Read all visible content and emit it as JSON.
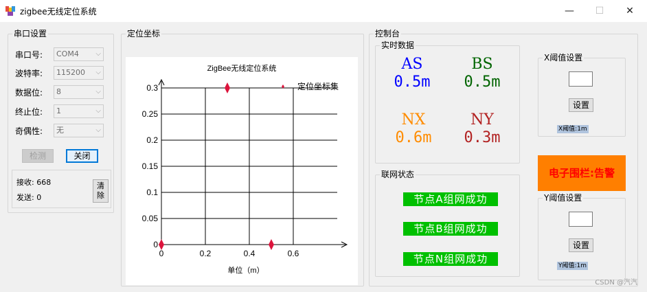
{
  "window": {
    "title": "zigbee无线定位系统",
    "minimize": "—",
    "maximize": "☐",
    "close": "✕"
  },
  "serial": {
    "legend": "串口设置",
    "fields": [
      {
        "label": "串口号:",
        "value": "COM4"
      },
      {
        "label": "波特率:",
        "value": "115200"
      },
      {
        "label": "数据位:",
        "value": "8"
      },
      {
        "label": "终止位:",
        "value": "1"
      },
      {
        "label": "奇偶性:",
        "value": "无"
      }
    ],
    "detect_label": "检测",
    "close_label": "关闭",
    "recv_label": "接收: 668",
    "send_label": "发送: 0",
    "clear_label_1": "清",
    "clear_label_2": "除"
  },
  "coords": {
    "legend": "定位坐标"
  },
  "chart_data": {
    "type": "scatter",
    "title": "ZigBee无线定位系统",
    "xlabel": "单位（m）",
    "ylabel": "",
    "xlim": [
      0,
      0.7
    ],
    "ylim": [
      0,
      0.3
    ],
    "xticks": [
      "0",
      "0.2",
      "0.4",
      "0.6"
    ],
    "yticks": [
      "0",
      "0.05",
      "0.1",
      "0.15",
      "0.2",
      "0.25",
      "0.3"
    ],
    "grid": true,
    "legend_position": "top-right",
    "series": [
      {
        "name": "定位坐标集",
        "color": "#dc143c",
        "x": [
          0,
          0.3,
          0.5
        ],
        "y": [
          0,
          0.3,
          0
        ]
      }
    ]
  },
  "console": {
    "legend": "控制台",
    "realtime": {
      "legend": "实时数据",
      "items": [
        {
          "label": "AS",
          "value": "0.5m",
          "color": "#0000ff"
        },
        {
          "label": "BS",
          "value": "0.5m",
          "color": "#006400"
        },
        {
          "label": "NX",
          "value": "0.6m",
          "color": "#ff8c00"
        },
        {
          "label": "NY",
          "value": "0.3m",
          "color": "#b22222"
        }
      ]
    },
    "network": {
      "legend": "联网状态",
      "items": [
        "节点A组网成功",
        "节点B组网成功",
        "节点N组网成功"
      ]
    },
    "x_threshold": {
      "legend": "X阈值设置",
      "button": "设置",
      "readout": "X阈值:1m"
    },
    "fence_alarm": "电子围栏:告警",
    "y_threshold": {
      "legend": "Y阈值设置",
      "button": "设置",
      "readout": "Y阈值:1m"
    }
  },
  "watermark": "CSDN @汽汽"
}
